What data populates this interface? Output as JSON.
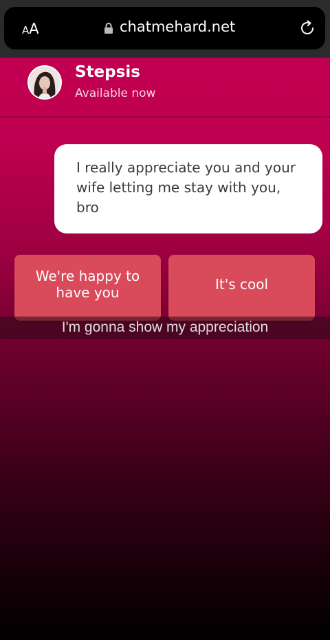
{
  "browser": {
    "text_size_small": "A",
    "text_size_big": "A",
    "url": "chatmehard.net",
    "icons": {
      "lock": "lock-icon",
      "reload": "reload-icon"
    }
  },
  "chat": {
    "contact_name": "Stepsis",
    "contact_status": "Available now",
    "messages": [
      {
        "text": "I really appreciate you and your wife letting me stay with you, bro"
      }
    ],
    "replies": [
      {
        "label": "We're happy to have you"
      },
      {
        "label": "It's cool"
      }
    ]
  },
  "caption": "I'm gonna show my appreciation",
  "colors": {
    "background_top": "#c30052",
    "background_bottom": "#000000",
    "reply_button": "#d94a5a",
    "bubble": "#ffffff"
  }
}
